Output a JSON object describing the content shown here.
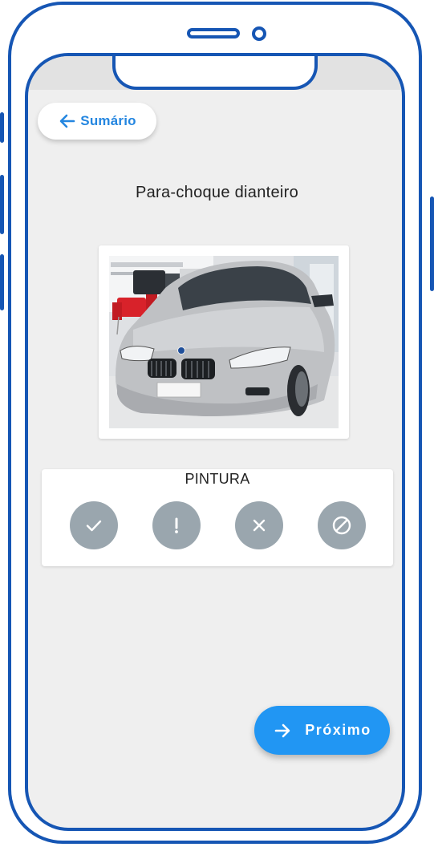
{
  "header": {
    "back_label": "Sumário"
  },
  "inspection": {
    "part_title": "Para-choque dianteiro",
    "photo_subject": "silver sedan front view in showroom"
  },
  "evaluation": {
    "heading": "PINTURA",
    "options": [
      {
        "icon": "check-icon"
      },
      {
        "icon": "exclamation-icon"
      },
      {
        "icon": "close-icon"
      },
      {
        "icon": "block-icon"
      }
    ],
    "option_color": "#9aa6ae"
  },
  "footer": {
    "next_label": "Próximo"
  },
  "colors": {
    "frame": "#1656b4",
    "accent": "#2196f3",
    "link": "#2486e0",
    "screen_bg": "#efefef"
  }
}
